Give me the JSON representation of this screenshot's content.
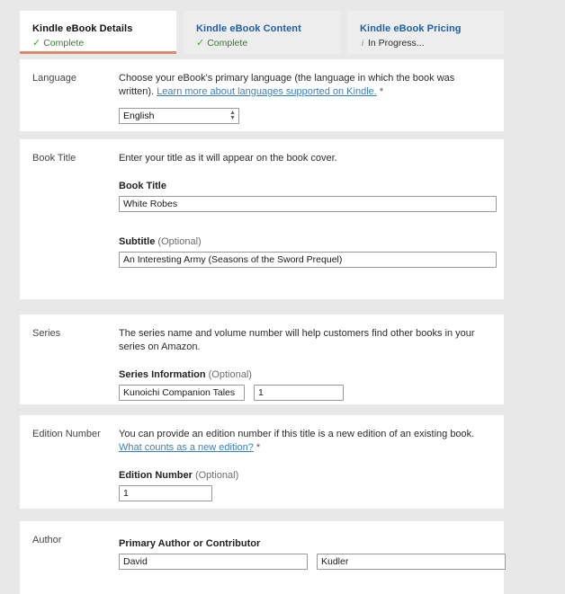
{
  "tabs": [
    {
      "title": "Kindle eBook Details",
      "status": "Complete",
      "state": "complete",
      "icon": "check-icon",
      "active": true
    },
    {
      "title": "Kindle eBook Content",
      "status": "Complete",
      "state": "complete",
      "icon": "check-icon",
      "active": false
    },
    {
      "title": "Kindle eBook Pricing",
      "status": "In Progress...",
      "state": "in-progress",
      "icon": "info-icon",
      "active": false
    }
  ],
  "language": {
    "section_label": "Language",
    "description_before_link": "Choose your eBook's primary language (the language in which the book was written). ",
    "link_text": "Learn more about languages supported on Kindle.",
    "required_mark": "*",
    "selected": "English",
    "options": [
      "English"
    ]
  },
  "book_title": {
    "section_label": "Book Title",
    "description": "Enter your title as it will appear on the book cover.",
    "title_label": "Book Title",
    "title_value": "White Robes",
    "title_placeholder": "",
    "subtitle_label": "Subtitle",
    "subtitle_optional": "(Optional)",
    "subtitle_value": "An Interesting Army (Seasons of the Sword Prequel)",
    "subtitle_placeholder": ""
  },
  "series": {
    "section_label": "Series",
    "description": "The series name and volume number will help customers find other books in your series on Amazon.",
    "info_label": "Series Information",
    "info_optional": "(Optional)",
    "name_value": "Kunoichi Companion Tales",
    "name_placeholder": "",
    "number_value": "1",
    "number_placeholder": ""
  },
  "edition": {
    "section_label": "Edition Number",
    "description_before_link": "You can provide an edition number if this title is a new edition of an existing book. ",
    "link_text": "What counts as a new edition?",
    "required_mark": "*",
    "field_label": "Edition Number",
    "field_optional": "(Optional)",
    "value": "1",
    "placeholder": ""
  },
  "author": {
    "section_label": "Author",
    "field_label": "Primary Author or Contributor",
    "first_name_value": "David",
    "first_name_placeholder": "",
    "last_name_value": "Kudler",
    "last_name_placeholder": ""
  },
  "icons": {
    "check": "✓",
    "info": "i",
    "select_arrows": "↕"
  },
  "colors": {
    "page_background": "#e8e8e8",
    "panel_background": "#ffffff",
    "active_tab_underline": "#d98c6a",
    "link_blue": "#3a7fc1",
    "tab_link_blue": "#1f5fa8",
    "complete_green": "#3a7a33"
  }
}
